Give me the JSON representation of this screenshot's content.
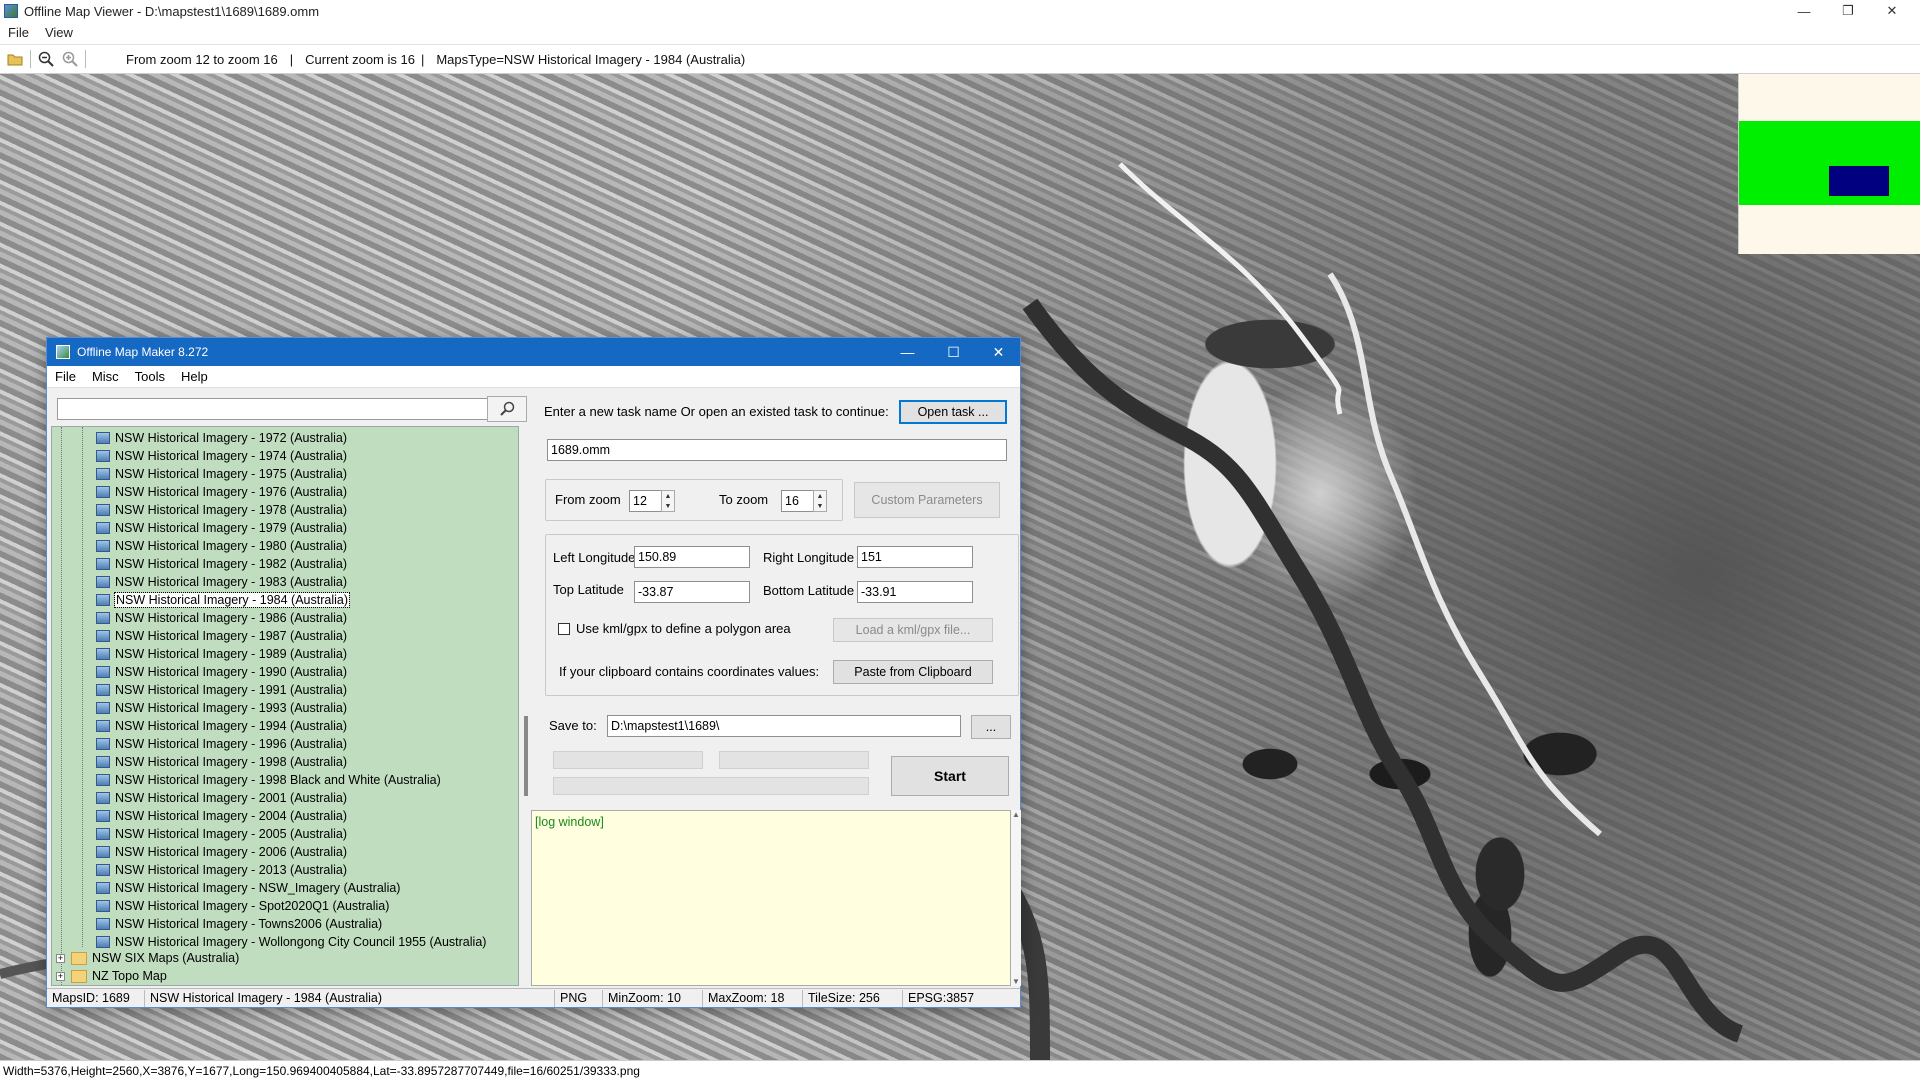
{
  "main_window": {
    "title": "Offline Map Viewer - D:\\mapstest1\\1689\\1689.omm",
    "menu": [
      "File",
      "View"
    ],
    "toolbar": {
      "zoom_range_text": "From zoom 12 to zoom 16",
      "current_zoom_text": "Current zoom is 16",
      "maps_type_text": "MapsType=NSW Historical Imagery - 1984 (Australia)",
      "separator": "|"
    },
    "status_text": "Width=5376,Height=2560,X=3876,Y=1677,Long=150.969400405884,Lat=-33.8957287707449,file=16/60251/39333.png"
  },
  "minimap": {
    "viewport_color": "#00ee00",
    "marker_color": "#000080"
  },
  "dialog": {
    "title": "Offline Map Maker 8.272",
    "menu": [
      "File",
      "Misc",
      "Tools",
      "Help"
    ],
    "search": {
      "value": "",
      "placeholder": ""
    },
    "tree": {
      "items": [
        {
          "label": "NSW Historical Imagery - 1972 (Australia)",
          "selected": false
        },
        {
          "label": "NSW Historical Imagery - 1974 (Australia)",
          "selected": false
        },
        {
          "label": "NSW Historical Imagery - 1975 (Australia)",
          "selected": false
        },
        {
          "label": "NSW Historical Imagery - 1976 (Australia)",
          "selected": false
        },
        {
          "label": "NSW Historical Imagery - 1978 (Australia)",
          "selected": false
        },
        {
          "label": "NSW Historical Imagery - 1979 (Australia)",
          "selected": false
        },
        {
          "label": "NSW Historical Imagery - 1980 (Australia)",
          "selected": false
        },
        {
          "label": "NSW Historical Imagery - 1982 (Australia)",
          "selected": false
        },
        {
          "label": "NSW Historical Imagery - 1983 (Australia)",
          "selected": false
        },
        {
          "label": "NSW Historical Imagery - 1984 (Australia)",
          "selected": true
        },
        {
          "label": "NSW Historical Imagery - 1986 (Australia)",
          "selected": false
        },
        {
          "label": "NSW Historical Imagery - 1987 (Australia)",
          "selected": false
        },
        {
          "label": "NSW Historical Imagery - 1989 (Australia)",
          "selected": false
        },
        {
          "label": "NSW Historical Imagery - 1990 (Australia)",
          "selected": false
        },
        {
          "label": "NSW Historical Imagery - 1991 (Australia)",
          "selected": false
        },
        {
          "label": "NSW Historical Imagery - 1993 (Australia)",
          "selected": false
        },
        {
          "label": "NSW Historical Imagery - 1994 (Australia)",
          "selected": false
        },
        {
          "label": "NSW Historical Imagery - 1996 (Australia)",
          "selected": false
        },
        {
          "label": "NSW Historical Imagery - 1998 (Australia)",
          "selected": false
        },
        {
          "label": "NSW Historical Imagery - 1998 Black and White (Australia)",
          "selected": false
        },
        {
          "label": "NSW Historical Imagery - 2001 (Australia)",
          "selected": false
        },
        {
          "label": "NSW Historical Imagery - 2004 (Australia)",
          "selected": false
        },
        {
          "label": "NSW Historical Imagery - 2005 (Australia)",
          "selected": false
        },
        {
          "label": "NSW Historical Imagery - 2006 (Australia)",
          "selected": false
        },
        {
          "label": "NSW Historical Imagery - 2013 (Australia)",
          "selected": false
        },
        {
          "label": "NSW Historical Imagery - NSW_Imagery (Australia)",
          "selected": false
        },
        {
          "label": "NSW Historical Imagery - Spot2020Q1 (Australia)",
          "selected": false
        },
        {
          "label": "NSW Historical Imagery - Towns2006 (Australia)",
          "selected": false
        },
        {
          "label": "NSW Historical Imagery - Wollongong City Council 1955 (Australia)",
          "selected": false
        }
      ],
      "folders": [
        {
          "label": "NSW SIX Maps (Australia)",
          "expander": "+"
        },
        {
          "label": "NZ Topo Map",
          "expander": "+"
        }
      ]
    },
    "task": {
      "prompt": "Enter a new task name Or open an existed task to continue:",
      "open_button": "Open task ...",
      "name_value": "1689.omm"
    },
    "zoom": {
      "from_label": "From zoom",
      "from_value": "12",
      "to_label": "To zoom",
      "to_value": "16",
      "custom_button": "Custom Parameters"
    },
    "coords": {
      "left_lon_label": "Left Longitude",
      "left_lon_value": "150.89",
      "right_lon_label": "Right Longitude",
      "right_lon_value": "151",
      "top_lat_label": "Top Latitude",
      "top_lat_value": "-33.87",
      "bottom_lat_label": "Bottom Latitude",
      "bottom_lat_value": "-33.91",
      "kml_checkbox_label": "Use kml/gpx to define a polygon area",
      "kml_checked": false,
      "load_kml_button": "Load a kml/gpx file...",
      "clipboard_label": "If your clipboard contains coordinates values:",
      "paste_button": "Paste from Clipboard"
    },
    "save": {
      "label": "Save to:",
      "path_value": "D:\\mapstest1\\1689\\",
      "browse_button": "...",
      "start_button": "Start"
    },
    "log_text": "[log window]",
    "status": {
      "maps_id": "MapsID: 1689",
      "maps_name": "NSW Historical Imagery - 1984 (Australia)",
      "format": "PNG",
      "min_zoom": "MinZoom: 10",
      "max_zoom": "MaxZoom: 18",
      "tile_size": "TileSize: 256",
      "epsg": "EPSG:3857"
    }
  }
}
